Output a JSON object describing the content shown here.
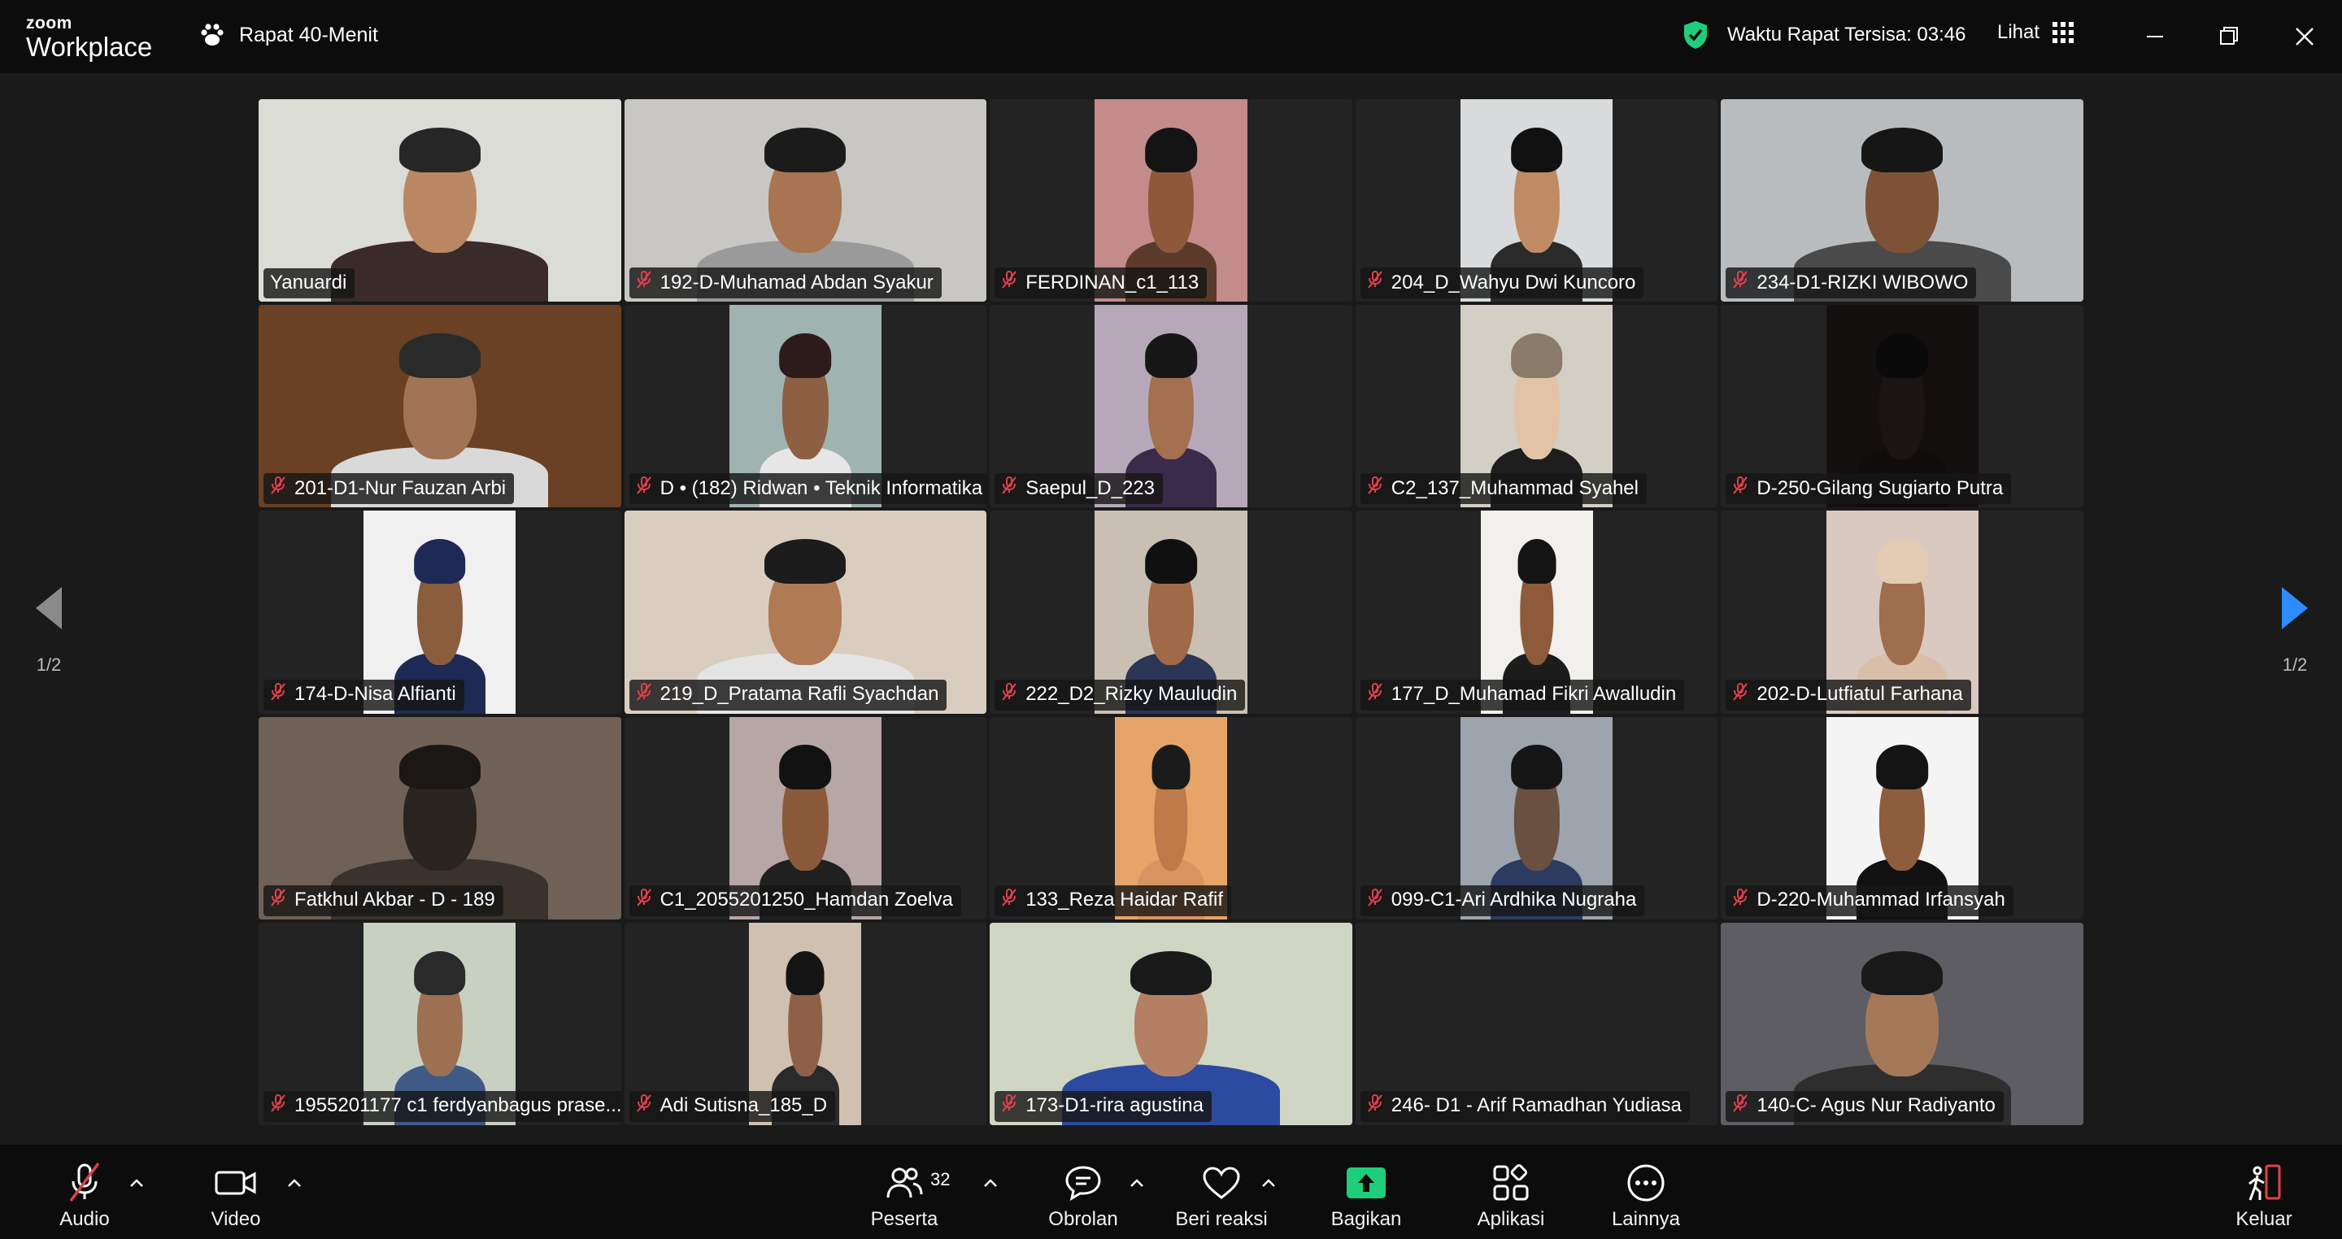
{
  "app": {
    "brand_small": "zoom",
    "brand_big": "Workplace",
    "meeting_title": "Rapat 40-Menit"
  },
  "header": {
    "timer_text": "Waktu Rapat Tersisa: 03:46",
    "view_label": "Lihat"
  },
  "pager": {
    "left_label": "1/2",
    "right_label": "1/2"
  },
  "participants": [
    {
      "name": "Yanuardi",
      "muted": false
    },
    {
      "name": "192-D-Muhamad Abdan Syakur",
      "muted": true
    },
    {
      "name": "FERDINAN_c1_113",
      "muted": true
    },
    {
      "name": "204_D_Wahyu Dwi Kuncoro",
      "muted": true
    },
    {
      "name": "234-D1-RIZKI WIBOWO",
      "muted": true
    },
    {
      "name": "201-D1-Nur Fauzan Arbi",
      "muted": true
    },
    {
      "name": "D • (182) Ridwan • Teknik Informatika",
      "muted": true
    },
    {
      "name": "Saepul_D_223",
      "muted": true
    },
    {
      "name": "C2_137_Muhammad Syahel",
      "muted": true
    },
    {
      "name": "D-250-Gilang Sugiarto Putra",
      "muted": true
    },
    {
      "name": "174-D-Nisa Alfianti",
      "muted": true
    },
    {
      "name": "219_D_Pratama Rafli Syachdan",
      "muted": true
    },
    {
      "name": "222_D2_Rizky Mauludin",
      "muted": true
    },
    {
      "name": "177_D_Muhamad Fikri Awalludin",
      "muted": true
    },
    {
      "name": "202-D-Lutfiatul Farhana",
      "muted": true
    },
    {
      "name": "Fatkhul Akbar - D - 189",
      "muted": true
    },
    {
      "name": "C1_2055201250_Hamdan Zoelva",
      "muted": true
    },
    {
      "name": "133_Reza Haidar Rafif",
      "muted": true
    },
    {
      "name": "099-C1-Ari Ardhika Nugraha",
      "muted": true
    },
    {
      "name": "D-220-Muhammad Irfansyah",
      "muted": true
    },
    {
      "name": "1955201177 c1 ferdyanbagus prase...",
      "muted": true
    },
    {
      "name": "Adi Sutisna_185_D",
      "muted": true
    },
    {
      "name": "173-D1-rira agustina",
      "muted": true
    },
    {
      "name": "246- D1 - Arif Ramadhan Yudiasa",
      "muted": true
    },
    {
      "name": "140-C- Agus Nur Radiyanto",
      "muted": true
    }
  ],
  "toolbar": {
    "audio": "Audio",
    "video": "Video",
    "participants": "Peserta",
    "participant_count": "32",
    "chat": "Obrolan",
    "react": "Beri reaksi",
    "share": "Bagikan",
    "apps": "Aplikasi",
    "more": "Lainnya",
    "leave": "Keluar"
  },
  "colors": {
    "active_speaker": "#1fce7b",
    "share_green": "#1fce7b",
    "mute_red": "#e0404b",
    "nav_arrow": "#2d8cff"
  }
}
